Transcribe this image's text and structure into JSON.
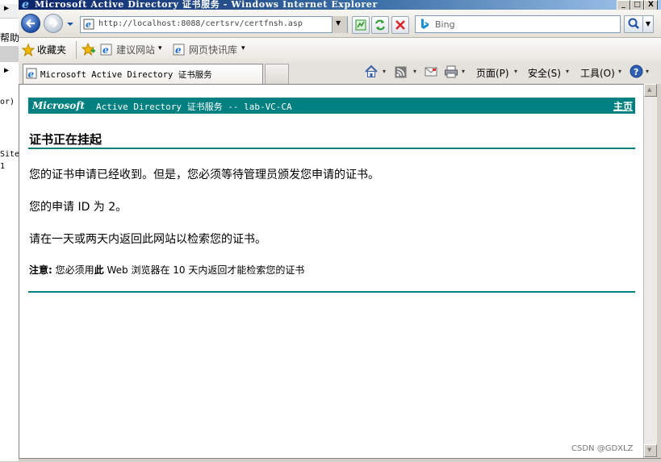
{
  "window": {
    "title": "Microsoft Active Directory 证书服务 - Windows Internet Explorer",
    "minimize_glyph": "_",
    "maximize_glyph": "□",
    "close_glyph": "X"
  },
  "background_window": {
    "arrow_glyph": "▶",
    "help_text": "帮助",
    "fragment_1": "or)",
    "fragment_2": "Site",
    "fragment_3": "1"
  },
  "address_bar": {
    "url": "http://localhost:8088/certsrv/certfnsh.asp",
    "dropdown_glyph": "▼"
  },
  "search": {
    "placeholder": "Bing",
    "dropdown_glyph": "▼"
  },
  "favorites_bar": {
    "favorites_label": "收藏夹",
    "suggested_sites": "建议网站",
    "web_slice_gallery": "网页快讯库",
    "dropdown_glyph": "▾"
  },
  "tabs": [
    {
      "label": "Microsoft Active Directory 证书服务"
    }
  ],
  "command_bar": {
    "page_menu": "页面(P)",
    "safety_menu": "安全(S)",
    "tools_menu": "工具(O)",
    "dropdown_glyph": "▾"
  },
  "page": {
    "header_brand": "Microsoft",
    "header_service": "Active Directory 证书服务  --  lab-VC-CA",
    "header_home_link": "主页",
    "title": "证书正在挂起",
    "paragraph_1": "您的证书申请已经收到。但是，您必须等待管理员颁发您申请的证书。",
    "paragraph_2": "您的申请 ID 为 2。",
    "paragraph_3": "请在一天或两天内返回此网站以检索您的证书。",
    "note_label": "注意:",
    "note_text_before": " 您必须用",
    "note_text_bold": "此",
    "note_text_after": " Web 浏览器在 10 天内返回才能检索您的证书"
  },
  "scrollbar": {
    "up_glyph": "▲",
    "down_glyph": "▼"
  },
  "watermark": "CSDN @GDXLZ"
}
